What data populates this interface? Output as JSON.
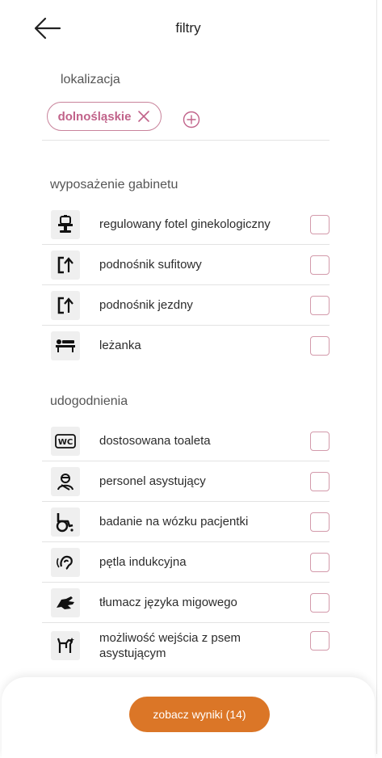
{
  "header": {
    "title": "filtry"
  },
  "location": {
    "label": "lokalizacja",
    "chip": "dolnośląskie"
  },
  "equipment": {
    "label": "wyposażenie gabinetu",
    "items": [
      {
        "label": "regulowany fotel ginekologiczny",
        "icon": "gynecological-chair-icon",
        "checked": false
      },
      {
        "label": "podnośnik sufitowy",
        "icon": "ceiling-lift-icon",
        "checked": false
      },
      {
        "label": "podnośnik jezdny",
        "icon": "mobile-lift-icon",
        "checked": false
      },
      {
        "label": "leżanka",
        "icon": "couch-icon",
        "checked": false
      }
    ]
  },
  "amenities": {
    "label": "udogodnienia",
    "items": [
      {
        "label": "dostosowana toaleta",
        "icon": "wc-icon",
        "checked": false
      },
      {
        "label": "personel asystujący",
        "icon": "assistant-staff-icon",
        "checked": false
      },
      {
        "label": "badanie na wózku pacjentki",
        "icon": "wheelchair-icon",
        "checked": false
      },
      {
        "label": "pętla indukcyjna",
        "icon": "hearing-loop-icon",
        "checked": false
      },
      {
        "label": "tłumacz języka migowego",
        "icon": "sign-language-icon",
        "checked": false
      },
      {
        "label": "możliwość wejścia z psem asystującym",
        "icon": "assistance-dog-icon",
        "checked": false
      }
    ]
  },
  "footer": {
    "button_label": "zobacz wyniki (14)"
  },
  "colors": {
    "accent": "#c1638a",
    "button": "#db7627",
    "checkbox_border": "#d39aab"
  }
}
